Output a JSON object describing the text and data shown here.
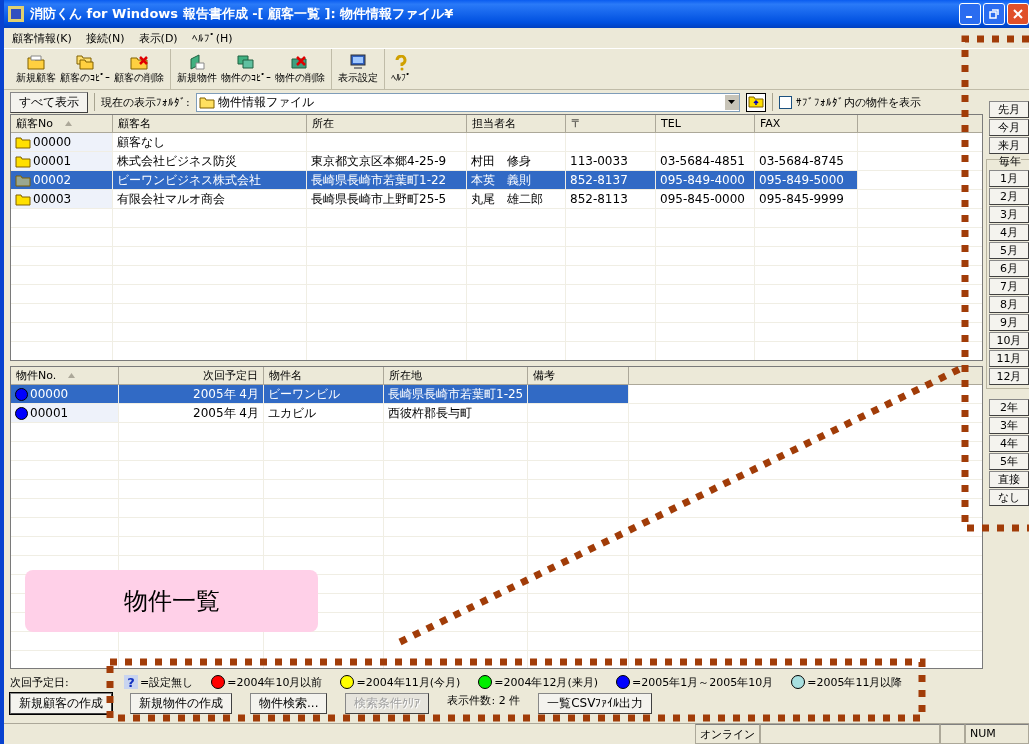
{
  "window": {
    "title": "消防くん for Windows 報告書作成 -[ 顧客一覧 ]: 物件情報ファイル¥"
  },
  "menu": [
    "顧客情報(K)",
    "接続(N)",
    "表示(D)",
    "ﾍﾙﾌﾟ(H)"
  ],
  "toolbar": {
    "groups": [
      {
        "items": [
          "新規顧客",
          "顧客のｺﾋﾟｰ",
          "顧客の削除"
        ]
      },
      {
        "items": [
          "新規物件",
          "物件のｺﾋﾟｰ",
          "物件の削除"
        ]
      },
      {
        "items": [
          "表示設定"
        ]
      },
      {
        "items": [
          "ﾍﾙﾌﾟ"
        ]
      }
    ]
  },
  "folder_bar": {
    "show_all": "すべて表示",
    "label": "現在の表示ﾌｫﾙﾀﾞ:",
    "folder": "物件情報ファイル",
    "subfolder": {
      "label": "ｻﾌﾞﾌｫﾙﾀﾞ内の物件を表示",
      "checked": false
    }
  },
  "customer_table": {
    "columns": [
      {
        "label": "顧客No",
        "sorted": true
      },
      {
        "label": "顧客名",
        "sorted": false
      },
      {
        "label": "所在",
        "sorted": false
      },
      {
        "label": "担当者名",
        "sorted": false
      },
      {
        "label": "〒",
        "sorted": false
      },
      {
        "label": "TEL",
        "sorted": false
      },
      {
        "label": "FAX",
        "sorted": false
      }
    ],
    "rows": [
      {
        "selected": false,
        "cells": [
          "00000",
          "顧客なし",
          "",
          "",
          "",
          "",
          ""
        ]
      },
      {
        "selected": false,
        "cells": [
          "00001",
          "株式会社ビジネス防災",
          "東京都文京区本郷4-25-9",
          "村田　修身",
          "113-0033",
          "03-5684-4851",
          "03-5684-8745"
        ]
      },
      {
        "selected": true,
        "cells": [
          "00002",
          "ビーワンビジネス株式会社",
          "長崎県長崎市若葉町1-22",
          "本英　義則",
          "852-8137",
          "095-849-4000",
          "095-849-5000"
        ]
      },
      {
        "selected": false,
        "cells": [
          "00003",
          "有限会社マルオ商会",
          "長崎県長崎市上野町25-5",
          "丸尾　雄二郎",
          "852-8113",
          "095-845-0000",
          "095-845-9999"
        ]
      }
    ]
  },
  "property_table": {
    "columns": [
      {
        "label": "物件No.",
        "sorted": true
      },
      {
        "label": "次回予定日",
        "sorted": false
      },
      {
        "label": "物件名",
        "sorted": false
      },
      {
        "label": "所在地",
        "sorted": false
      },
      {
        "label": "備考",
        "sorted": false
      }
    ],
    "rows": [
      {
        "selected": true,
        "color": "#0000ff",
        "cells": [
          "00000",
          "2005年 4月",
          "ビーワンビル",
          "長崎県長崎市若葉町1-25",
          ""
        ]
      },
      {
        "selected": false,
        "color": "#0000ff",
        "cells": [
          "00001",
          "2005年 4月",
          "ユカビル",
          "西彼杵郡長与町",
          ""
        ]
      }
    ]
  },
  "sidebar": {
    "top": [
      {
        "label": "先月"
      },
      {
        "label": "今月"
      },
      {
        "label": "来月"
      }
    ],
    "group": {
      "label": "毎年",
      "items": [
        "1月",
        "2月",
        "3月",
        "4月",
        "5月",
        "6月",
        "7月",
        "8月",
        "9月",
        "10月",
        "11月",
        "12月"
      ]
    },
    "bottom": [
      {
        "label": "2年"
      },
      {
        "label": "3年"
      },
      {
        "label": "4年"
      },
      {
        "label": "5年"
      },
      {
        "label": "直接"
      },
      {
        "label": "なし"
      }
    ]
  },
  "legend": {
    "label": "次回予定日:",
    "items": [
      {
        "kind": "unset",
        "symbol": "?",
        "label": "=設定無し"
      },
      {
        "kind": "dot",
        "color": "#ff0000",
        "label": "=2004年10月以前"
      },
      {
        "kind": "dot",
        "color": "#ffff00",
        "label": "=2004年11月(今月)"
      },
      {
        "kind": "dot",
        "color": "#00ee00",
        "label": "=2004年12月(来月)"
      },
      {
        "kind": "dot",
        "color": "#0000ff",
        "label": "=2005年1月～2005年10月"
      },
      {
        "kind": "dot",
        "color": "#a8e0e0",
        "label": "=2005年11月以降"
      }
    ]
  },
  "actions": [
    {
      "label": "新規顧客の作成",
      "kind": "default",
      "disabled": false
    },
    {
      "label": "新規物件の作成",
      "kind": "button",
      "disabled": false
    },
    {
      "label": "物件検索...",
      "kind": "button",
      "disabled": false
    },
    {
      "label": "検索条件ｸﾘｱ",
      "kind": "button",
      "disabled": true
    },
    {
      "label": "表示件数: 2 件",
      "kind": "text"
    },
    {
      "label": "一覧CSVﾌｧｲﾙ出力",
      "kind": "button",
      "disabled": false
    }
  ],
  "status_bar": [
    "オンライン",
    "NUM"
  ],
  "callout": {
    "label": "物件一覧"
  }
}
